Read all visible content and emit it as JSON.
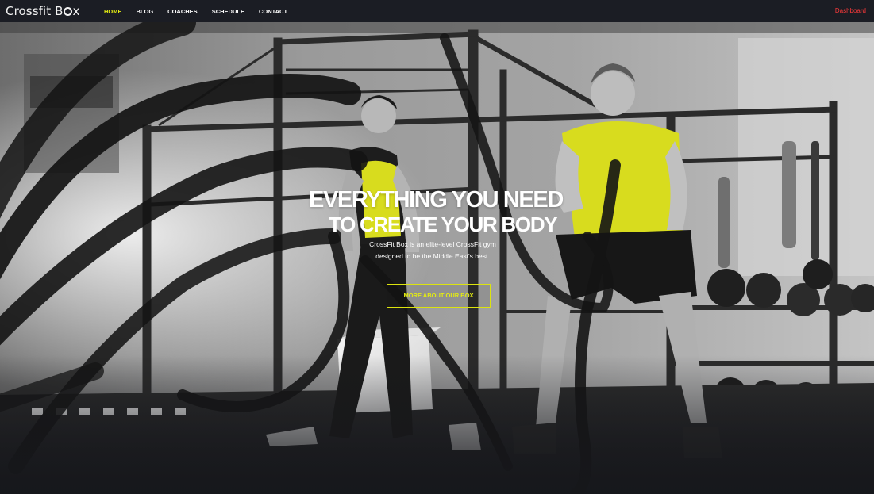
{
  "brand": {
    "logo_prefix": "Crossfit B",
    "logo_suffix": "x"
  },
  "nav": {
    "items": [
      {
        "label": "HOME",
        "active": true
      },
      {
        "label": "BLOG",
        "active": false
      },
      {
        "label": "COACHES",
        "active": false
      },
      {
        "label": "SCHEDULE",
        "active": false
      },
      {
        "label": "CONTACT",
        "active": false
      }
    ],
    "dashboard_label": "Dashboard"
  },
  "hero": {
    "headline_line1": "EVERYTHING YOU NEED",
    "headline_line2": "TO CREATE YOUR BODY",
    "tagline_line1": "CrossFit Box is an elite-level CrossFit gym",
    "tagline_line2": "designed to be the Middle East's best.",
    "cta_label": "MORE ABOUT OUR BOX"
  },
  "colors": {
    "accent": "#e3eb12",
    "nav_background": "#1b1d24",
    "dashboard": "#ff3a3a",
    "shirt_yellow": "#d8dc1e"
  }
}
